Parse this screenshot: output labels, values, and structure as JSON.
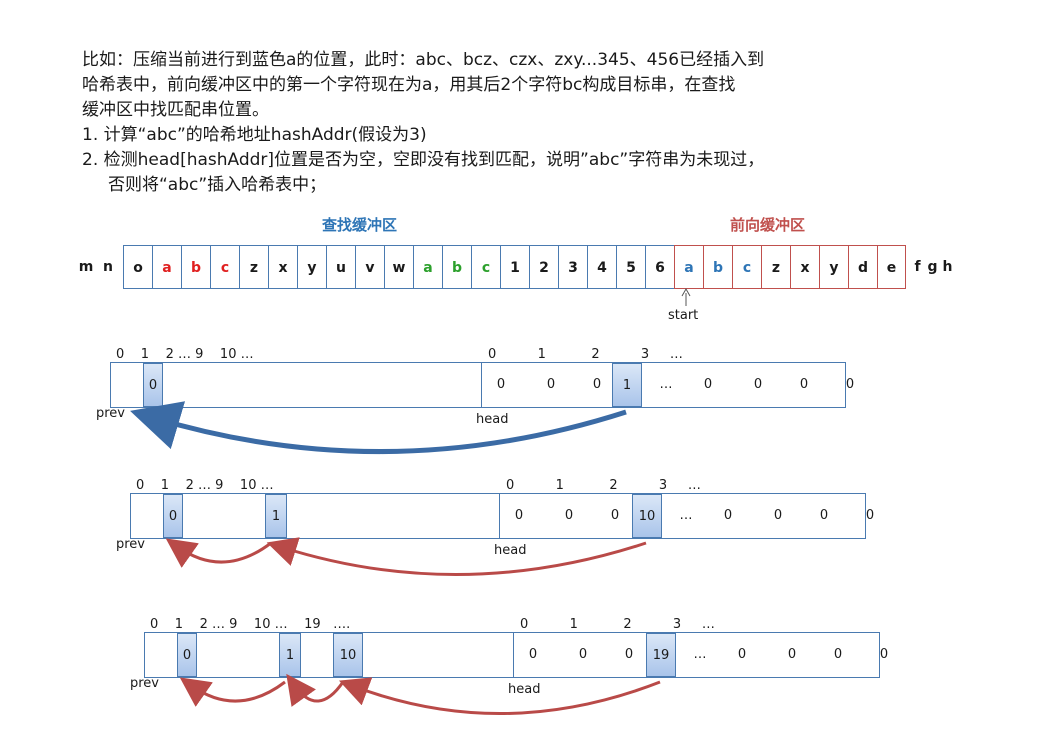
{
  "intro": {
    "line1": "比如：压缩当前进行到蓝色a的位置，此时：abc、bcz、czx、zxy...345、456已经插入到",
    "line2": "哈希表中，前向缓冲区中的第一个字符现在为a，用其后2个字符bc构成目标串，在查找",
    "line3": "缓冲区中找匹配串位置。",
    "step1": "1. 计算“abc”的哈希地址hashAddr(假设为3)",
    "step2a": "2. 检测head[hashAddr]位置是否为空，空即没有找到匹配，说明”abc”字符串为未现过，",
    "step2b": "否则将“abc”插入哈希表中；"
  },
  "labels": {
    "search_buffer": "查找缓冲区",
    "lookahead_buffer": "前向缓冲区",
    "start": "start",
    "prev": "prev",
    "head": "head"
  },
  "colors": {
    "search_buffer": "#2e75b6",
    "lookahead_buffer": "#c0504d",
    "red_char": "#e02020",
    "green_char": "#2ca02c",
    "blue_char": "#2e75b6",
    "arrow_blue": "#3b6ba5",
    "arrow_red": "#b94a48"
  },
  "stream": {
    "before": [
      {
        "c": "m",
        "color": "#1a1a1a"
      },
      {
        "c": "n",
        "color": "#1a1a1a"
      }
    ],
    "search": [
      {
        "c": "o",
        "color": "#1a1a1a"
      },
      {
        "c": "a",
        "color": "#e02020"
      },
      {
        "c": "b",
        "color": "#e02020"
      },
      {
        "c": "c",
        "color": "#e02020"
      },
      {
        "c": "z",
        "color": "#1a1a1a"
      },
      {
        "c": "x",
        "color": "#1a1a1a"
      },
      {
        "c": "y",
        "color": "#1a1a1a"
      },
      {
        "c": "u",
        "color": "#1a1a1a"
      },
      {
        "c": "v",
        "color": "#1a1a1a"
      },
      {
        "c": "w",
        "color": "#1a1a1a"
      },
      {
        "c": "a",
        "color": "#2ca02c"
      },
      {
        "c": "b",
        "color": "#2ca02c"
      },
      {
        "c": "c",
        "color": "#2ca02c"
      },
      {
        "c": "1",
        "color": "#1a1a1a"
      },
      {
        "c": "2",
        "color": "#1a1a1a"
      },
      {
        "c": "3",
        "color": "#1a1a1a"
      },
      {
        "c": "4",
        "color": "#1a1a1a"
      },
      {
        "c": "5",
        "color": "#1a1a1a"
      },
      {
        "c": "6",
        "color": "#1a1a1a"
      }
    ],
    "lookahead": [
      {
        "c": "a",
        "color": "#2e75b6"
      },
      {
        "c": "b",
        "color": "#2e75b6"
      },
      {
        "c": "c",
        "color": "#2e75b6"
      },
      {
        "c": "z",
        "color": "#1a1a1a"
      },
      {
        "c": "x",
        "color": "#1a1a1a"
      },
      {
        "c": "y",
        "color": "#1a1a1a"
      },
      {
        "c": "d",
        "color": "#1a1a1a"
      },
      {
        "c": "e",
        "color": "#1a1a1a"
      }
    ],
    "after": [
      {
        "c": "f",
        "color": "#1a1a1a"
      },
      {
        "c": "g",
        "color": "#1a1a1a"
      },
      {
        "c": "h",
        "color": "#1a1a1a"
      }
    ]
  },
  "tables": [
    {
      "prev_index_label": "0    1    2 … 9    10 …",
      "head_index_label": "0          1           2          3     …",
      "prev_values": [
        "0"
      ],
      "head_values": [
        "0",
        "0",
        "0",
        "1",
        "…",
        "0",
        "0",
        "0",
        "0"
      ]
    },
    {
      "prev_index_label": "0    1    2 … 9    10 …",
      "head_index_label": "0          1           2          3     …",
      "prev_values": [
        "0",
        "1"
      ],
      "head_values": [
        "0",
        "0",
        "0",
        "10",
        "…",
        "0",
        "0",
        "0",
        "0"
      ]
    },
    {
      "prev_index_label": "0    1    2 … 9    10 …    19   ….",
      "head_index_label": "0          1           2          3     …",
      "prev_values": [
        "0",
        "1",
        "10"
      ],
      "head_values": [
        "0",
        "0",
        "0",
        "19",
        "…",
        "0",
        "0",
        "0",
        "0"
      ]
    }
  ]
}
